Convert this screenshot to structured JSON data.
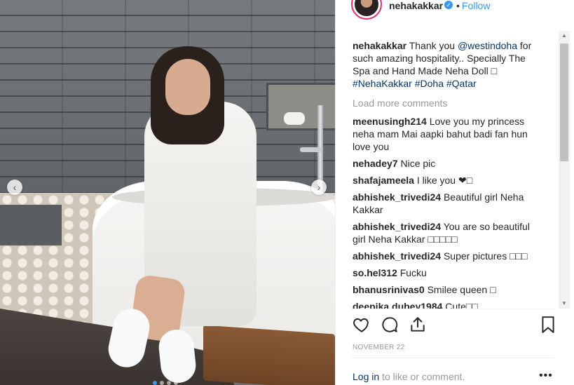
{
  "header": {
    "username": "nehakakkar",
    "separator": "•",
    "follow_label": "Follow",
    "verified_symbol": "✓"
  },
  "caption": {
    "username": "nehakakkar",
    "text_1": "Thank you ",
    "mention": "@westindoha",
    "text_2": " for such amazing hospitality.. Specially The Spa and Hand Made Neha Doll □ ",
    "hashtag_1": "#NehaKakkar",
    "hashtag_2": "#Doha",
    "hashtag_3": "#Qatar"
  },
  "load_more_label": "Load more comments",
  "comments": [
    {
      "username": "meenusingh214",
      "text": "Love you my princess neha mam Mai aapki bahut badi fan hun love you"
    },
    {
      "username": "nehadey7",
      "text": "Nice pic"
    },
    {
      "username": "shafajameela",
      "text": "I like you ❤□"
    },
    {
      "username": "abhishek_trivedi24",
      "text": "Beautiful girl Neha Kakkar"
    },
    {
      "username": "abhishek_trivedi24",
      "text": "You are so beautiful girl Neha Kakkar □□□□□"
    },
    {
      "username": "abhishek_trivedi24",
      "text": "Super pictures □□□"
    },
    {
      "username": "so.hel312",
      "text": "Fucku"
    },
    {
      "username": "bhanusrinivas0",
      "text": "Smilee queen □"
    },
    {
      "username": "deepika.dubey1984",
      "text": "Cute□□"
    }
  ],
  "post_date": "NOVEMBER 22",
  "login": {
    "link_text": "Log in",
    "rest_text": " to like or comment.",
    "more_label": "•••"
  },
  "carousel": {
    "prev_symbol": "‹",
    "next_symbol": "›",
    "dot_count": 4,
    "active_index": 0
  },
  "icons": [
    "heart-icon",
    "comment-icon",
    "share-icon",
    "bookmark-icon"
  ],
  "colors": {
    "accent": "#3897f0",
    "link": "#003569",
    "muted": "#999999"
  }
}
